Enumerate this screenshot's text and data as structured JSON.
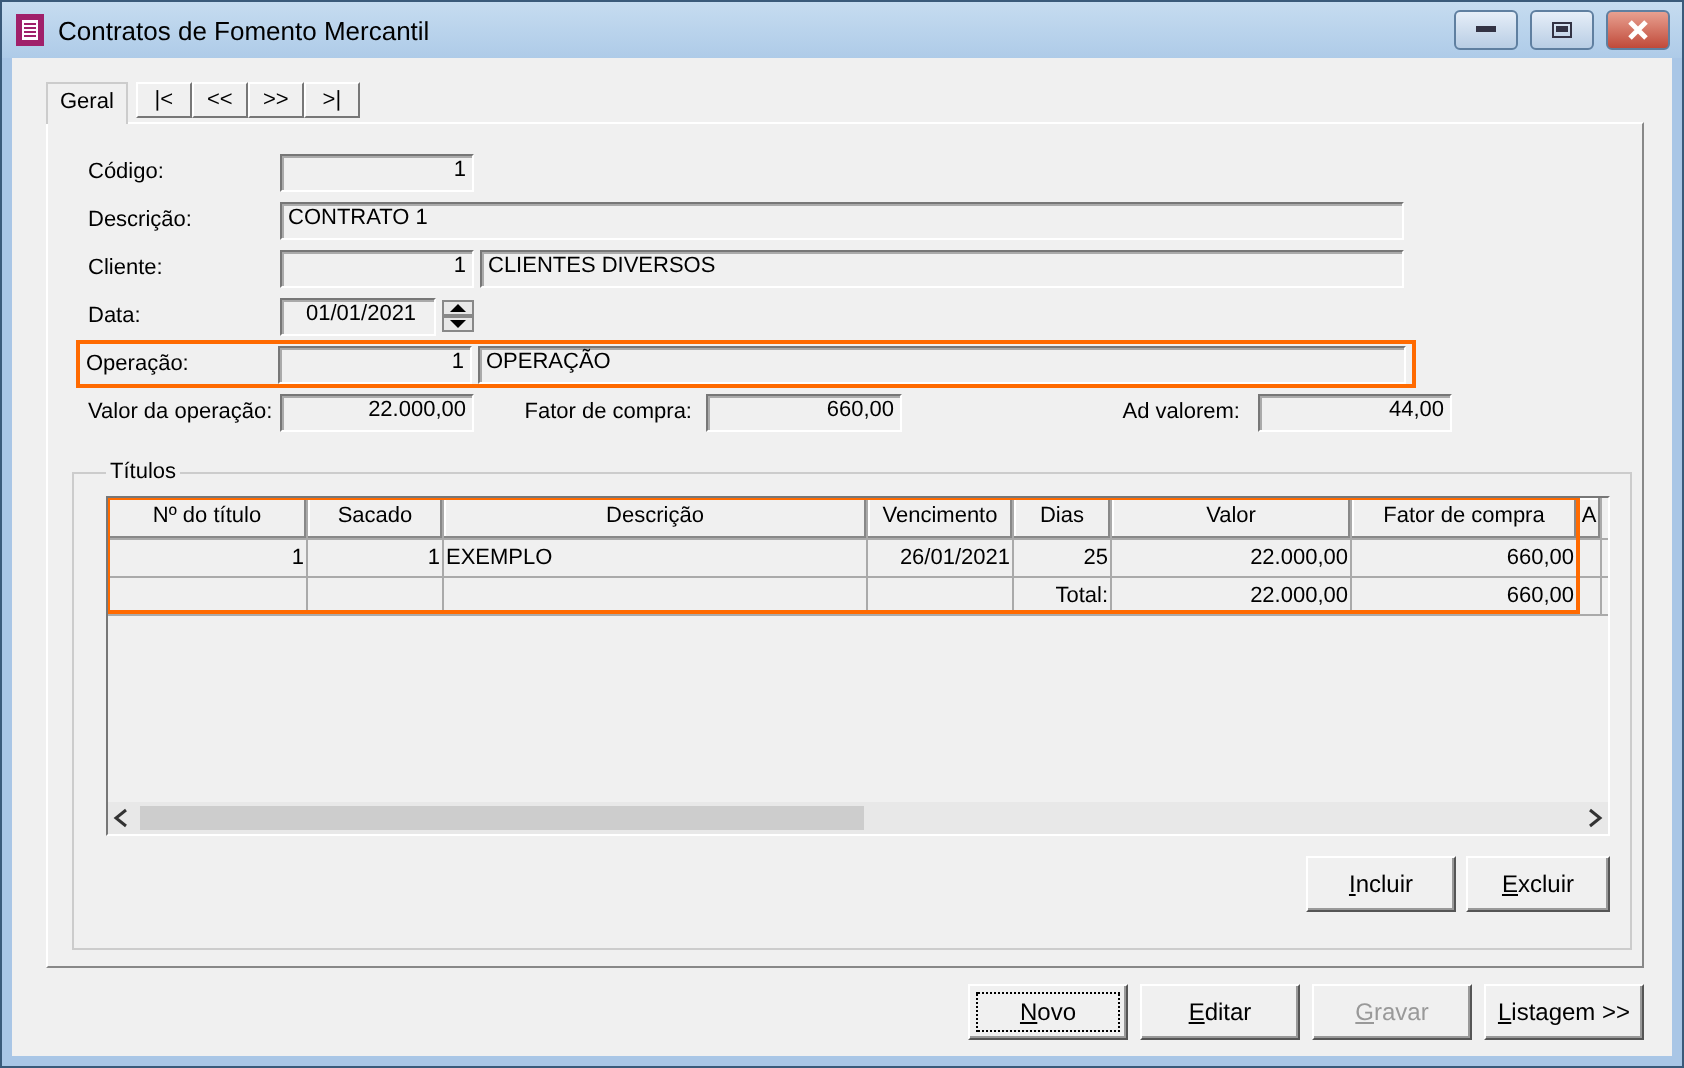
{
  "window": {
    "title": "Contratos de Fomento Mercantil"
  },
  "tabs": [
    {
      "label": "Geral",
      "selected": true
    }
  ],
  "nav_buttons": [
    "|<",
    "<<",
    ">>",
    ">|"
  ],
  "form": {
    "codigo": {
      "label": "Código:",
      "value": "1"
    },
    "descricao": {
      "label": "Descrição:",
      "value": "CONTRATO 1"
    },
    "cliente": {
      "label": "Cliente:",
      "code": "1",
      "name": "CLIENTES DIVERSOS"
    },
    "data": {
      "label": "Data:",
      "value": "01/01/2021"
    },
    "operacao": {
      "label": "Operação:",
      "code": "1",
      "name": "OPERAÇÃO",
      "highlighted": true
    },
    "valor_operacao": {
      "label": "Valor da operação:",
      "value": "22.000,00"
    },
    "fator_compra": {
      "label": "Fator de compra:",
      "value": "660,00"
    },
    "ad_valorem": {
      "label": "Ad valorem:",
      "value": "44,00"
    }
  },
  "titulos": {
    "title": "Títulos",
    "highlighted": true,
    "columns": [
      "Nº do título",
      "Sacado",
      "Descrição",
      "Vencimento",
      "Dias",
      "Valor",
      "Fator de compra",
      "A"
    ],
    "rows": [
      [
        "1",
        "1",
        "EXEMPLO",
        "26/01/2021",
        "25",
        "22.000,00",
        "660,00",
        ""
      ],
      [
        "",
        "",
        "",
        "",
        "Total:",
        "22.000,00",
        "660,00",
        ""
      ]
    ],
    "buttons": [
      {
        "label": "Incluir",
        "disabled": false
      },
      {
        "label": "Excluir",
        "disabled": false
      }
    ]
  },
  "buttons": [
    {
      "label": "Novo",
      "disabled": false,
      "focused": true
    },
    {
      "label": "Editar",
      "disabled": false,
      "focused": false
    },
    {
      "label": "Gravar",
      "disabled": true,
      "focused": false
    },
    {
      "label": "Listagem >>",
      "disabled": false,
      "focused": false
    }
  ]
}
